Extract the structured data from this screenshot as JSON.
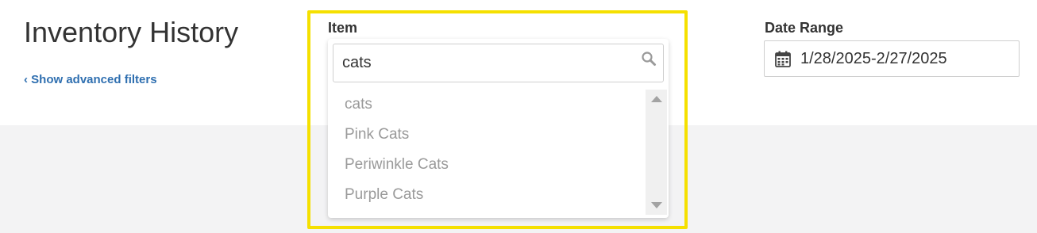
{
  "header": {
    "title": "Inventory History",
    "advanced_filters_link": "‹ Show advanced filters"
  },
  "item_filter": {
    "label": "Item",
    "search_value": "cats",
    "options": [
      "cats",
      "Pink Cats",
      "Periwinkle Cats",
      "Purple Cats"
    ]
  },
  "date_filter": {
    "label": "Date Range",
    "value": "1/28/2025-2/27/2025"
  },
  "colors": {
    "highlight": "#f5e000",
    "link": "#2f6fb0",
    "option_text": "#9a9a9a"
  },
  "icons": [
    "search-icon",
    "calendar-icon",
    "scroll-up-arrow-icon",
    "scroll-down-arrow-icon"
  ]
}
